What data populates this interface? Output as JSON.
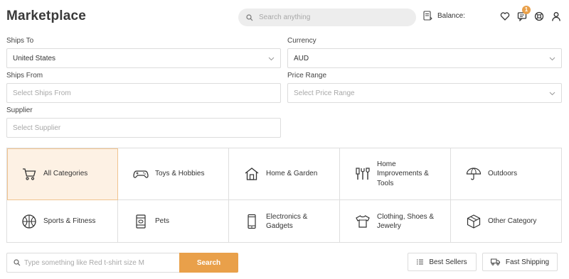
{
  "header": {
    "title": "Marketplace",
    "search_placeholder": "Search anything",
    "balance_label": "Balance:",
    "notification_count": "1",
    "accent_color": "#e9a04a"
  },
  "filters": {
    "ships_to": {
      "label": "Ships To",
      "value": "United States"
    },
    "currency": {
      "label": "Currency",
      "value": "AUD"
    },
    "ships_from": {
      "label": "Ships From",
      "placeholder": "Select Ships From"
    },
    "price_range": {
      "label": "Price Range",
      "placeholder": "Select Price Range"
    },
    "supplier": {
      "label": "Supplier",
      "placeholder": "Select Supplier"
    }
  },
  "categories": [
    {
      "label": "All Categories",
      "icon": "cart-icon",
      "active": true
    },
    {
      "label": "Toys & Hobbies",
      "icon": "gamepad-icon"
    },
    {
      "label": "Home & Garden",
      "icon": "house-icon"
    },
    {
      "label": "Home Improvements & Tools",
      "icon": "tools-icon"
    },
    {
      "label": "Outdoors",
      "icon": "umbrella-icon"
    },
    {
      "label": "Sports & Fitness",
      "icon": "basketball-icon"
    },
    {
      "label": "Pets",
      "icon": "pet-food-icon"
    },
    {
      "label": "Electronics & Gadgets",
      "icon": "smartphone-icon"
    },
    {
      "label": "Clothing, Shoes & Jewelry",
      "icon": "tshirt-icon"
    },
    {
      "label": "Other Category",
      "icon": "box-icon"
    }
  ],
  "product_search": {
    "placeholder": "Type something like Red t-shirt size M",
    "button_label": "Search"
  },
  "quick_filters": {
    "best_sellers": "Best Sellers",
    "fast_shipping": "Fast Shipping"
  }
}
